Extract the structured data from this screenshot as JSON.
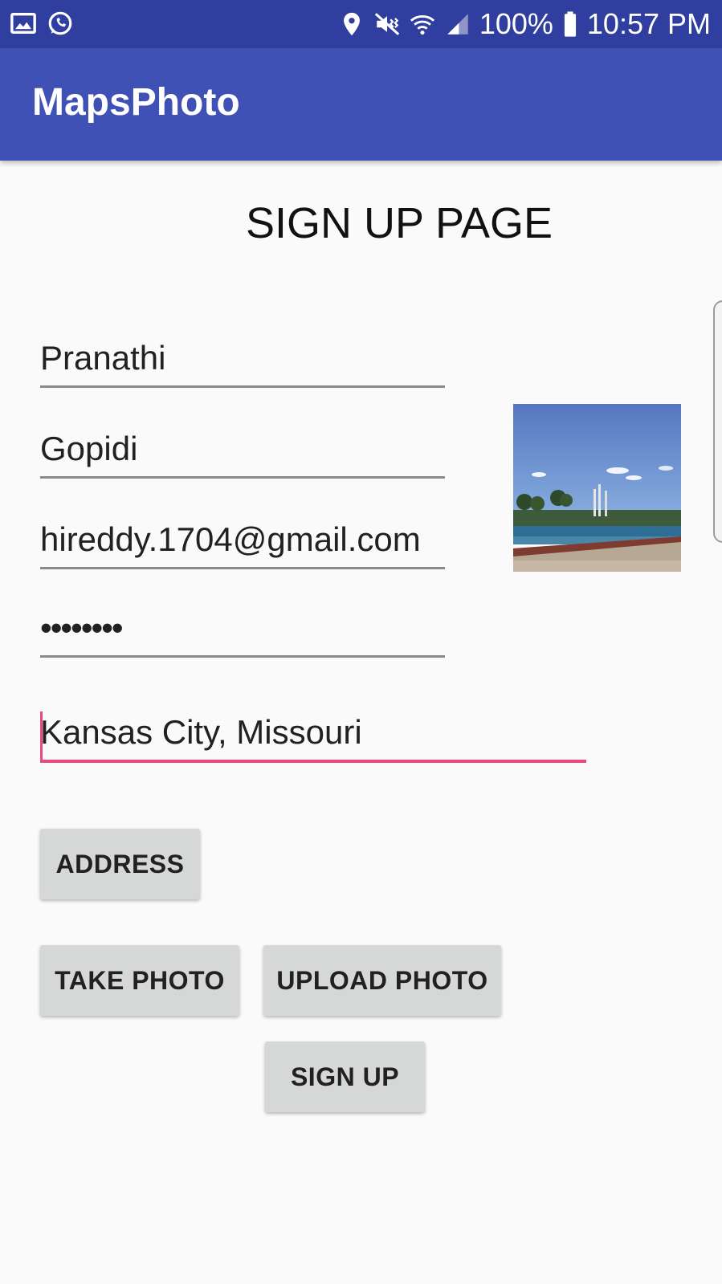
{
  "status_bar": {
    "battery": "100%",
    "time": "10:57 PM",
    "icons": [
      "image-icon",
      "whatsapp-icon",
      "location-icon",
      "mute-vibrate-icon",
      "wifi-icon",
      "signal-icon",
      "battery-icon"
    ]
  },
  "app_bar": {
    "title": "MapsPhoto"
  },
  "page": {
    "title": "SIGN UP PAGE"
  },
  "form": {
    "first_name": "Pranathi",
    "last_name": "Gopidi",
    "email": "hireddy.1704@gmail.com",
    "password": "••••••••",
    "address": "Kansas City, Missouri"
  },
  "buttons": {
    "address": "ADDRESS",
    "take_photo": "TAKE PHOTO",
    "upload_photo": "UPLOAD PHOTO",
    "sign_up": "SIGN UP"
  },
  "colors": {
    "status_bar": "#303f9f",
    "app_bar": "#3f51b5",
    "accent": "#e84a7f",
    "button": "#d6d7d7"
  }
}
